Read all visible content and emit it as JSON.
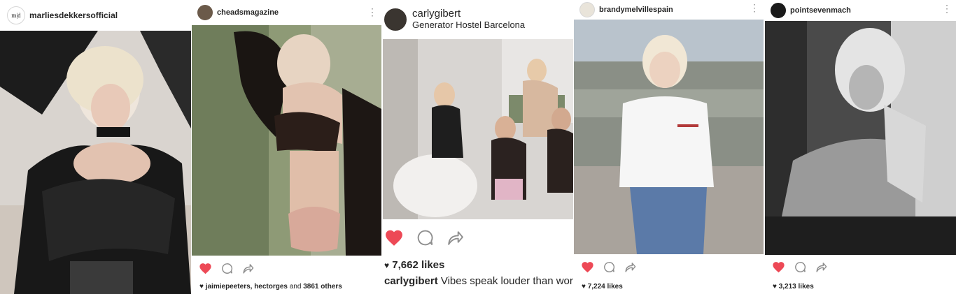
{
  "posts": [
    {
      "username": "marliesdekkersofficial",
      "avatar_text": "m|d"
    },
    {
      "username": "cheadsmagazine",
      "likes_heart": "♥",
      "likes_names": "jaimiepeeters, hectorges",
      "likes_and": " and ",
      "likes_others": "3861 others"
    },
    {
      "username": "carlygibert",
      "location": "Generator Hostel Barcelona",
      "likes_heart": "♥",
      "likes": "7,662 likes",
      "caption_user": "carlygibert",
      "caption_text": " Vibes speak louder than words"
    },
    {
      "username": "brandymelvillespain",
      "likes_heart": "♥",
      "likes": "7,224 likes"
    },
    {
      "username": "pointsevenmach",
      "likes_heart": "♥",
      "likes": "3,213 likes"
    }
  ],
  "icons": {
    "more": "more-options-icon",
    "like": "heart-icon",
    "comment": "comment-icon",
    "share": "share-icon"
  },
  "colors": {
    "like_red": "#ed4956",
    "text": "#262626",
    "icon_gray": "#8e8e8e"
  }
}
